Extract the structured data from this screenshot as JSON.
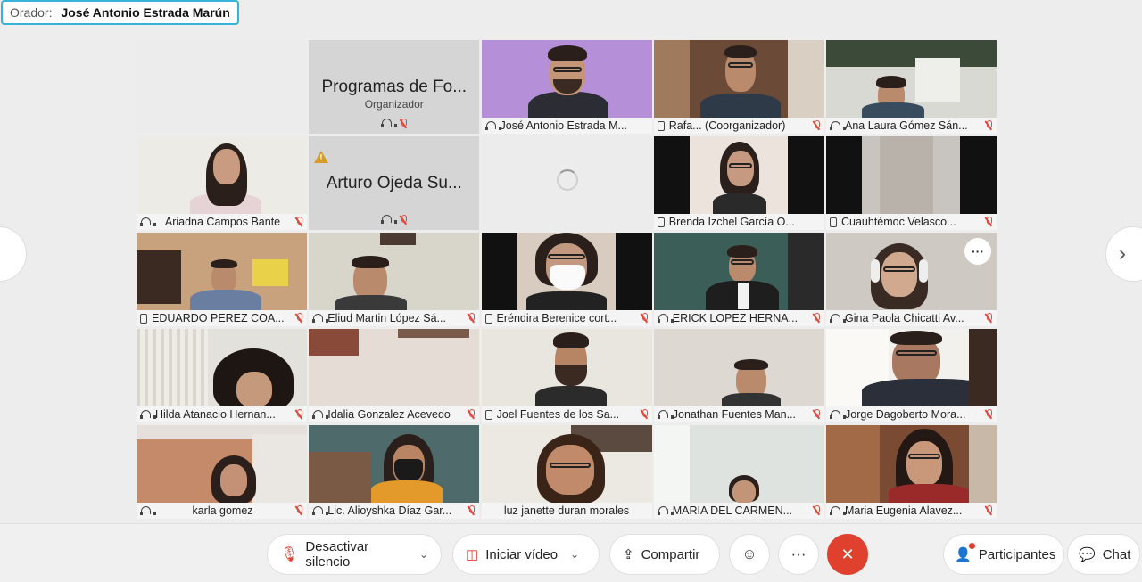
{
  "speaker": {
    "label": "Orador:",
    "name": "José Antonio Estrada Marún"
  },
  "tiles": [
    {
      "name": "",
      "device": "",
      "muted": false
    },
    {
      "name": "Programas de Fo...",
      "sub": "Organizador",
      "device": "headset",
      "muted": true
    },
    {
      "name": "José Antonio Estrada M...",
      "device": "headset",
      "muted": false
    },
    {
      "name": "Rafa...     (Coorganizador)",
      "device": "phone",
      "muted": true
    },
    {
      "name": "Ana Laura Gómez Sán...",
      "device": "headset",
      "muted": true
    },
    {
      "name": "Ariadna Campos Bante",
      "device": "headset",
      "muted": true
    },
    {
      "name": "Arturo Ojeda Su...",
      "device": "headset",
      "muted": true
    },
    {
      "name": "",
      "device": "",
      "muted": false
    },
    {
      "name": "Brenda Izchel García O...",
      "device": "phone",
      "muted": true
    },
    {
      "name": "Cuauhtémoc Velasco...",
      "device": "phone",
      "muted": true
    },
    {
      "name": "EDUARDO PEREZ COA...",
      "device": "phone",
      "muted": true
    },
    {
      "name": "Eliud Martin López Sá...",
      "device": "headset",
      "muted": true
    },
    {
      "name": "Eréndira Berenice cort...",
      "device": "phone",
      "muted": true
    },
    {
      "name": "ERICK LOPEZ HERNA...",
      "device": "headset",
      "muted": true
    },
    {
      "name": "Gina Paola Chicatti Av...",
      "device": "headset",
      "muted": true
    },
    {
      "name": "Hilda Atanacio Hernan...",
      "device": "headset",
      "muted": true
    },
    {
      "name": "Idalia Gonzalez Acevedo",
      "device": "headset",
      "muted": true
    },
    {
      "name": "Joel Fuentes de los Sa...",
      "device": "phone",
      "muted": true
    },
    {
      "name": "Jonathan Fuentes Man...",
      "device": "headset",
      "muted": true
    },
    {
      "name": "Jorge Dagoberto Mora...",
      "device": "headset",
      "muted": true
    },
    {
      "name": "karla gomez",
      "device": "headset",
      "muted": true
    },
    {
      "name": "Lic. Alioyshka Díaz Gar...",
      "device": "headset",
      "muted": true
    },
    {
      "name": "luz janette duran morales",
      "device": "",
      "muted": false
    },
    {
      "name": "MARIA DEL CARMEN...",
      "device": "headset",
      "muted": true
    },
    {
      "name": "Maria Eugenia Alavez...",
      "device": "headset",
      "muted": true
    }
  ],
  "tile_more": "···",
  "nav": {
    "prev": "‹",
    "next": "›"
  },
  "toolbar": {
    "unmute": "Desactivar silencio",
    "start_video": "Iniciar vídeo",
    "share": "Compartir",
    "reactions_icon": "emoji-icon",
    "more": "···",
    "end": "✕",
    "participants": "Participantes",
    "chat": "Chat"
  },
  "colors": {
    "accent": "#35b3d8",
    "danger": "#e0412f"
  }
}
